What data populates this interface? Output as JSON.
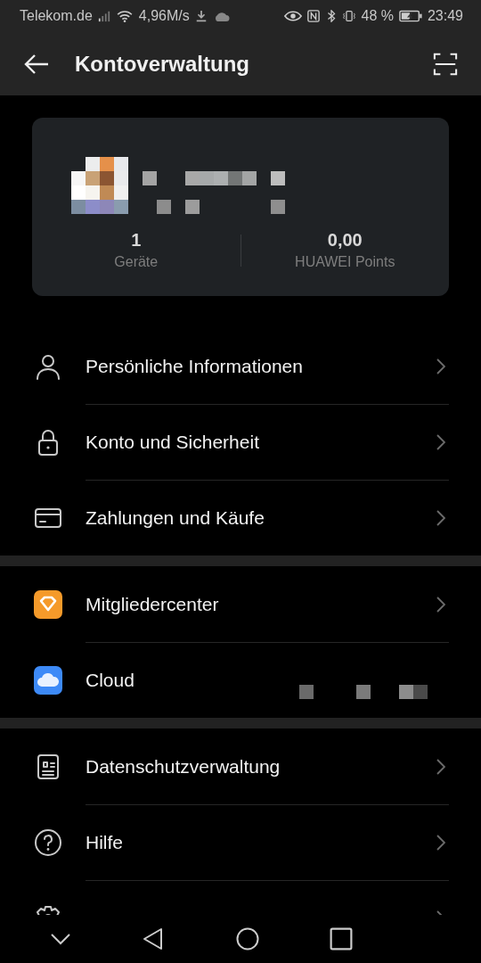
{
  "status_bar": {
    "carrier": "Telekom.de",
    "speed": "4,96M/s",
    "battery": "48 %",
    "time": "23:49"
  },
  "header": {
    "title": "Kontoverwaltung"
  },
  "account_card": {
    "stats": [
      {
        "value": "1",
        "label": "Geräte"
      },
      {
        "value": "0,00",
        "label": "HUAWEI Points"
      }
    ]
  },
  "sections": [
    {
      "items": [
        {
          "label": "Persönliche Informationen",
          "kind": "link"
        },
        {
          "label": "Konto und Sicherheit",
          "kind": "link"
        },
        {
          "label": "Zahlungen und Käufe",
          "kind": "link"
        }
      ]
    },
    {
      "items": [
        {
          "label": "Mitgliedercenter",
          "kind": "link"
        },
        {
          "label": "Cloud",
          "kind": "value"
        }
      ]
    },
    {
      "items": [
        {
          "label": "Datenschutzverwaltung",
          "kind": "link"
        },
        {
          "label": "Hilfe",
          "kind": "link"
        },
        {
          "kind": "link"
        }
      ]
    }
  ]
}
